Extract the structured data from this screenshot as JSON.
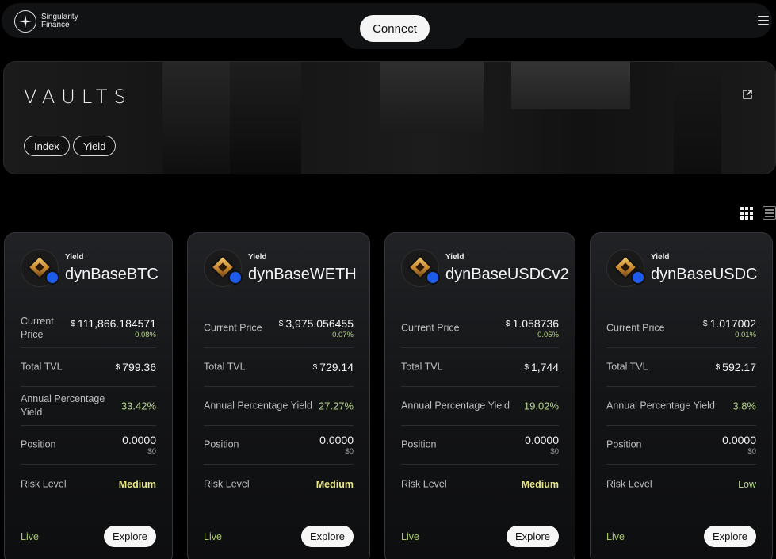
{
  "nav": {
    "brand_line1": "Singularity",
    "brand_line2": "Finance",
    "connect_label": "Connect"
  },
  "banner": {
    "title": "VAULTS",
    "chips": [
      "Index",
      "Yield"
    ]
  },
  "labels": {
    "current_price": "Current Price",
    "current_price_l1": "Current",
    "current_price_l2": "Price",
    "total_tvl": "Total TVL",
    "apy": "Annual Percentage Yield",
    "apy_l1": "Annual Percentage",
    "apy_l2": "Yield",
    "position": "Position",
    "risk": "Risk Level",
    "currency": "$",
    "explore": "Explore"
  },
  "cards": [
    {
      "type": "Yield",
      "name": "dynBaseBTC",
      "price": "111,866.184571",
      "price_change": "0.08%",
      "tvl": "799.36",
      "apy": "33.42%",
      "position": "0.0000",
      "position_usd": "$0",
      "risk": "Medium",
      "status": "Live"
    },
    {
      "type": "Yield",
      "name": "dynBaseWETH",
      "price": "3,975.056455",
      "price_change": "0.07%",
      "tvl": "729.14",
      "apy": "27.27%",
      "position": "0.0000",
      "position_usd": "$0",
      "risk": "Medium",
      "status": "Live"
    },
    {
      "type": "Yield",
      "name": "dynBaseUSDCv2",
      "price": "1.058736",
      "price_change": "0.05%",
      "tvl": "1,744",
      "apy": "19.02%",
      "position": "0.0000",
      "position_usd": "$0",
      "risk": "Medium",
      "status": "Live"
    },
    {
      "type": "Yield",
      "name": "dynBaseUSDC",
      "price": "1.017002",
      "price_change": "0.01%",
      "tvl": "592.17",
      "apy": "3.8%",
      "position": "0.0000",
      "position_usd": "$0",
      "risk": "Low",
      "status": "Live"
    }
  ],
  "icons": {
    "logo": "sparkle-logo-icon",
    "menu": "hamburger-menu-icon",
    "external": "external-link-icon",
    "grid_view": "grid-view-icon",
    "list_view": "list-view-icon",
    "vault": "diamond-vault-icon",
    "chain": "base-chain-icon"
  },
  "colors": {
    "background": "#000000",
    "card": "#17181a",
    "positive": "#b5d28a",
    "risk_medium": "#e8e68a",
    "chain_blue": "#1f5bea"
  }
}
